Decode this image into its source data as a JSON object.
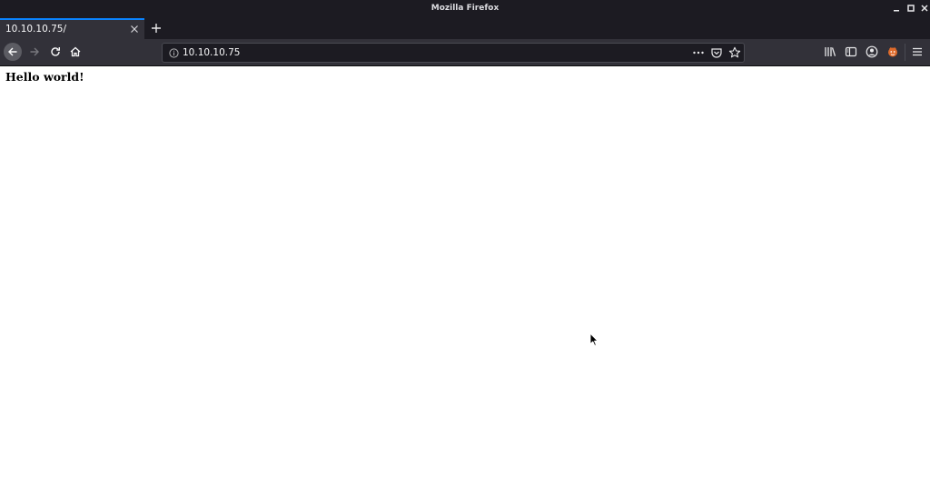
{
  "window": {
    "title": "Mozilla Firefox"
  },
  "tabs": [
    {
      "label": "10.10.10.75/",
      "active": true
    }
  ],
  "navbar": {
    "url": "10.10.10.75"
  },
  "page": {
    "heading": "Hello world!"
  },
  "theme": {
    "titlebar_bg": "#1c1b22",
    "toolbar_bg": "#323139",
    "tab_accent": "#0a84ff",
    "page_bg": "#ffffff"
  },
  "icons": {
    "wm": [
      "minimize-icon",
      "maximize-icon",
      "close-icon"
    ],
    "nav": [
      "back-arrow-icon",
      "forward-arrow-icon",
      "reload-icon",
      "home-icon"
    ],
    "url": [
      "info-icon",
      "page-actions-icon",
      "pocket-icon",
      "bookmark-star-icon"
    ],
    "toolbar": [
      "library-icon",
      "sidebar-icon",
      "account-icon",
      "extension-icon",
      "hamburger-menu-icon"
    ]
  }
}
